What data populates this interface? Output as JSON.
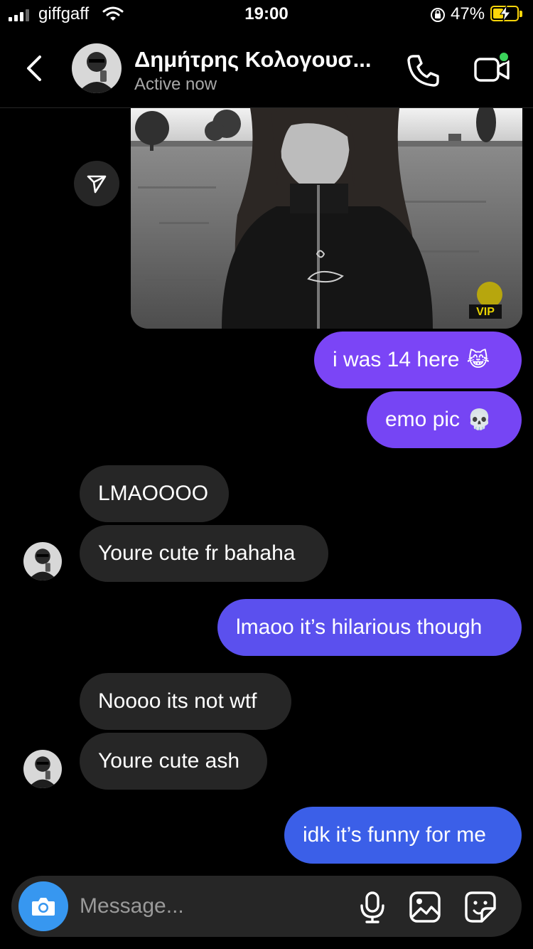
{
  "status_bar": {
    "carrier": "giffgaff",
    "time": "19:00",
    "battery_percent": "47%",
    "battery_level": 0.47,
    "battery_charging": true,
    "signal_bars": 3,
    "colors": {
      "battery": "#ffd60a"
    }
  },
  "header": {
    "back_icon": "chevron-left-icon",
    "contact_name": "Δημήτρης Κολογουσ...",
    "status": "Active now",
    "call_icon": "phone-icon",
    "video_icon": "video-camera-icon",
    "video_online_color": "#3ad35a"
  },
  "messages": [
    {
      "type": "photo",
      "direction": "outgoing",
      "watermark": "VIP"
    },
    {
      "type": "text",
      "direction": "outgoing",
      "text": "i was 14 here",
      "emoji": "😹",
      "color": "#7b45f6"
    },
    {
      "type": "text",
      "direction": "outgoing",
      "text": "emo pic",
      "emoji": "💀",
      "color": "#7645f4"
    },
    {
      "type": "text",
      "direction": "incoming",
      "text": "LMAOOOO"
    },
    {
      "type": "text",
      "direction": "incoming",
      "text": "Youre cute fr bahaha"
    },
    {
      "type": "text",
      "direction": "outgoing",
      "text": "lmaoo it’s hilarious though",
      "color": "#5b50ee"
    },
    {
      "type": "text",
      "direction": "incoming",
      "text": "Noooo its not wtf"
    },
    {
      "type": "text",
      "direction": "incoming",
      "text": "Youre cute ash"
    },
    {
      "type": "text",
      "direction": "outgoing",
      "text": "idk it’s funny for me",
      "color": "#3b5fe8"
    }
  ],
  "composer": {
    "placeholder": "Message...",
    "camera_icon": "camera-icon",
    "mic_icon": "microphone-icon",
    "gallery_icon": "gallery-icon",
    "sticker_icon": "sticker-icon",
    "camera_color": "#3797f0"
  }
}
